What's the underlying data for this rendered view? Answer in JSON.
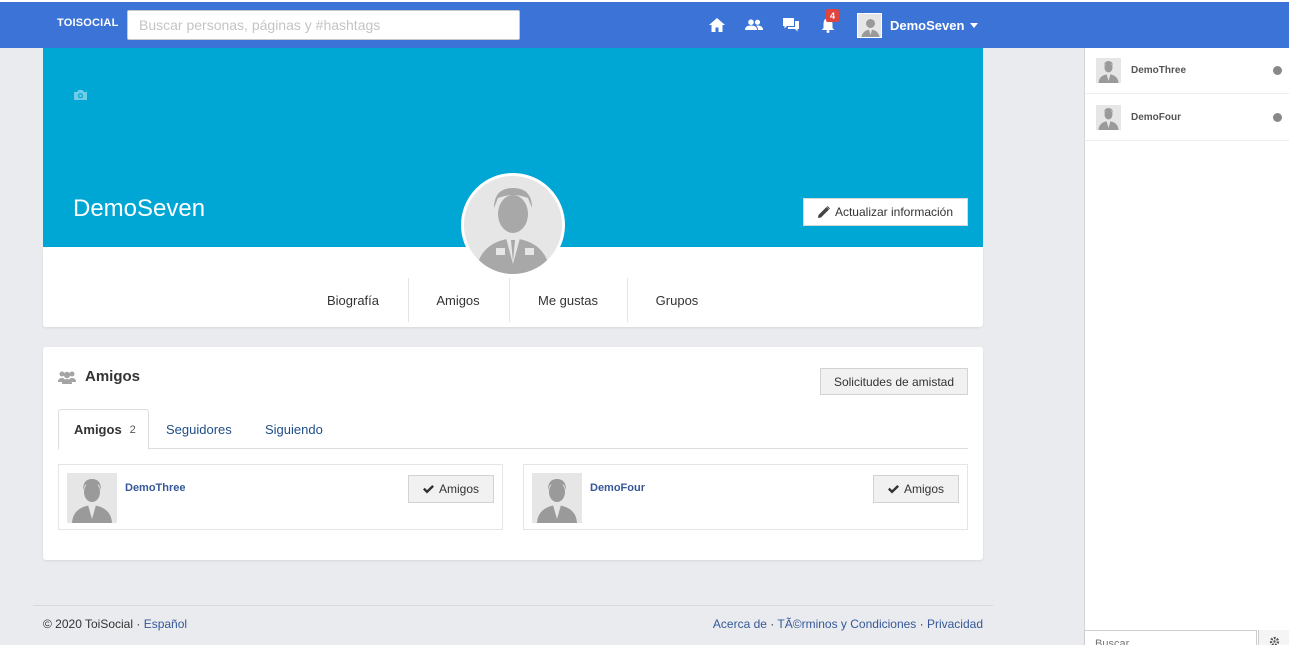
{
  "topbar": {
    "brand": "TOISOCIAL",
    "search_placeholder": "Buscar personas, páginas y #hashtags",
    "notification_count": "4",
    "user_name": "DemoSeven",
    "icons": [
      "home-icon",
      "friends-icon",
      "messages-icon",
      "notifications-icon"
    ],
    "accent_color": "#3b73d6"
  },
  "cover": {
    "name": "DemoSeven",
    "color": "#00a6d4",
    "update_button": "Actualizar información"
  },
  "profile_tabs": [
    "Biografía",
    "Amigos",
    "Me gustas",
    "Grupos"
  ],
  "friends_panel": {
    "title": "Amigos",
    "requests_button": "Solicitudes de amistad",
    "tabs": {
      "amigos": "Amigos",
      "amigos_count": "2",
      "seguidores": "Seguidores",
      "siguiendo": "Siguiendo"
    },
    "friends": [
      {
        "name": "DemoThree",
        "button": "Amigos"
      },
      {
        "name": "DemoFour",
        "button": "Amigos"
      }
    ]
  },
  "footer": {
    "copyright": "© 2020 ToiSocial · ",
    "language": "Español",
    "about": "Acerca de",
    "sep": " · ",
    "terms": "TÃ©rminos y Condiciones",
    "privacy": "Privacidad"
  },
  "chat": {
    "contacts": [
      {
        "name": "DemoThree"
      },
      {
        "name": "DemoFour"
      }
    ],
    "search_placeholder": "Buscar"
  }
}
